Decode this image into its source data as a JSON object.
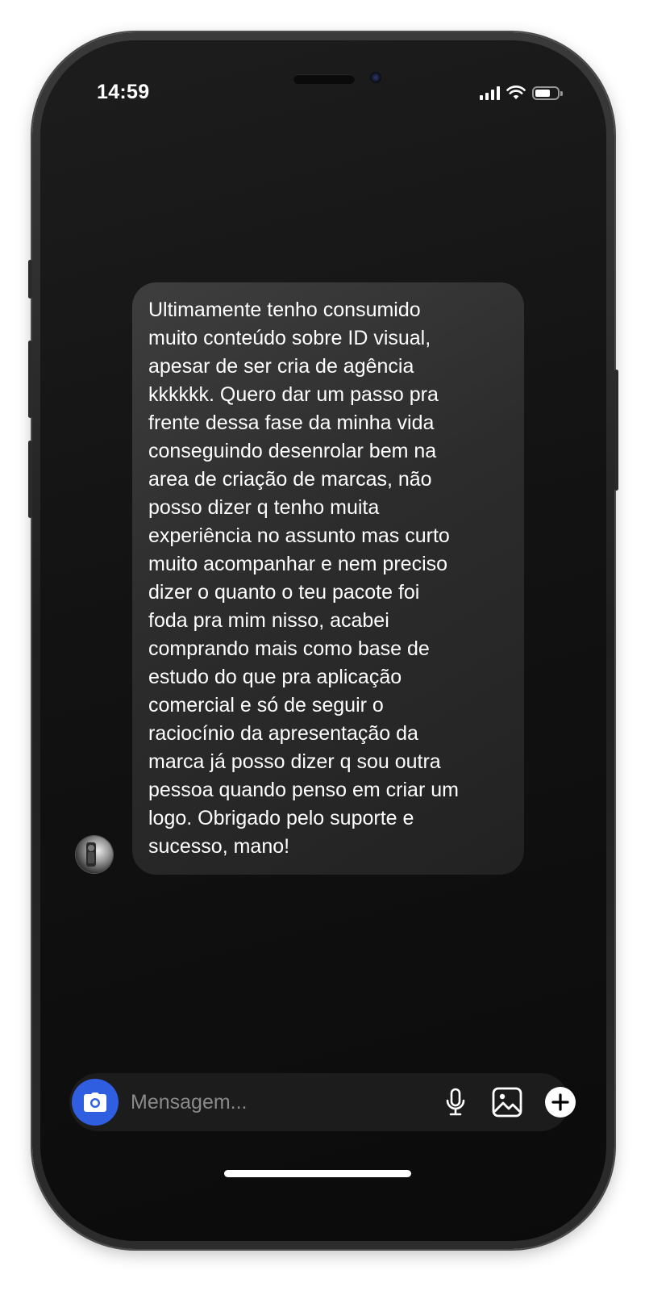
{
  "status_bar": {
    "time": "14:59",
    "signal_icon": "cellular-signal-icon",
    "wifi_icon": "wifi-icon",
    "battery_icon": "battery-icon",
    "battery_level": 0.7
  },
  "chat": {
    "message": "Ultimamente tenho consumido\nmuito conteúdo sobre ID visual,\napesar de ser cria de agência\nkkkkkk. Quero dar um passo pra\nfrente dessa fase da minha vida\nconseguindo desenrolar bem na\narea  de criação de marcas, não\nposso dizer q tenho muita\nexperiência no assunto mas curto\nmuito acompanhar e nem preciso\ndizer o quanto o teu pacote foi\nfoda pra mim nisso, acabei\ncomprando mais como base de\nestudo do que pra aplicação\ncomercial e só de seguir o\nraciocínio da apresentação da\nmarca já posso dizer q sou outra\npessoa quando penso em criar um\nlogo. Obrigado pelo suporte e\nsucesso, mano!",
    "avatar_icon": "avatar"
  },
  "composer": {
    "placeholder": "Mensagem...",
    "camera_icon": "camera-icon",
    "mic_icon": "microphone-icon",
    "gallery_icon": "image-icon",
    "add_icon": "plus-icon"
  },
  "colors": {
    "screen_background": "#121212",
    "bubble_background": "#2c2c2c",
    "camera_button": "#2f5fe0",
    "text": "#ffffff",
    "placeholder_text": "#8a8a8a"
  }
}
